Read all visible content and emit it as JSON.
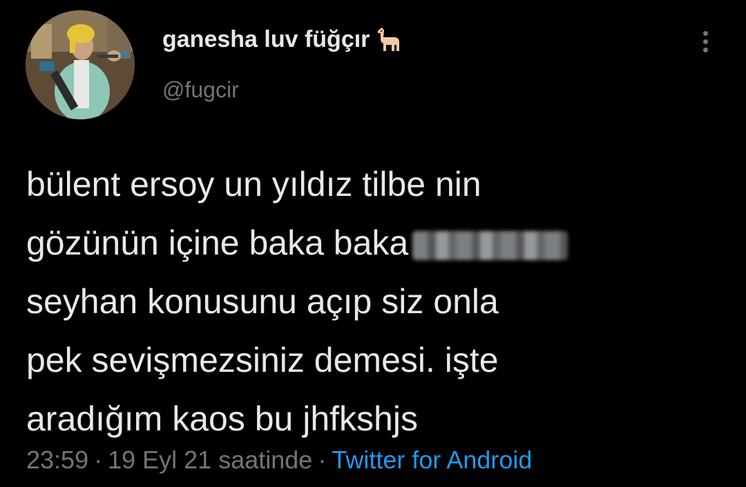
{
  "author": {
    "display_name": "ganesha luv füğçır",
    "name_emoji_icon": "llama-icon",
    "handle": "@fugcir",
    "avatar_icon": "profile-photo"
  },
  "tweet": {
    "lines": [
      "bülent ersoy un yıldız tilbe nin",
      "gözünün içine baka baka",
      "seyhan konusunu açıp siz onla",
      "pek sevişmezsiniz demesi. işte",
      "aradığım kaos bu jhfkshjs"
    ]
  },
  "meta": {
    "time": "23:59",
    "separator": "·",
    "date": "19 Eyl 21 saatinde",
    "source": "Twitter for Android"
  },
  "colors": {
    "background": "#000000",
    "text_primary": "#e7e9ea",
    "text_secondary": "#71767b",
    "link": "#1d9bf0"
  }
}
